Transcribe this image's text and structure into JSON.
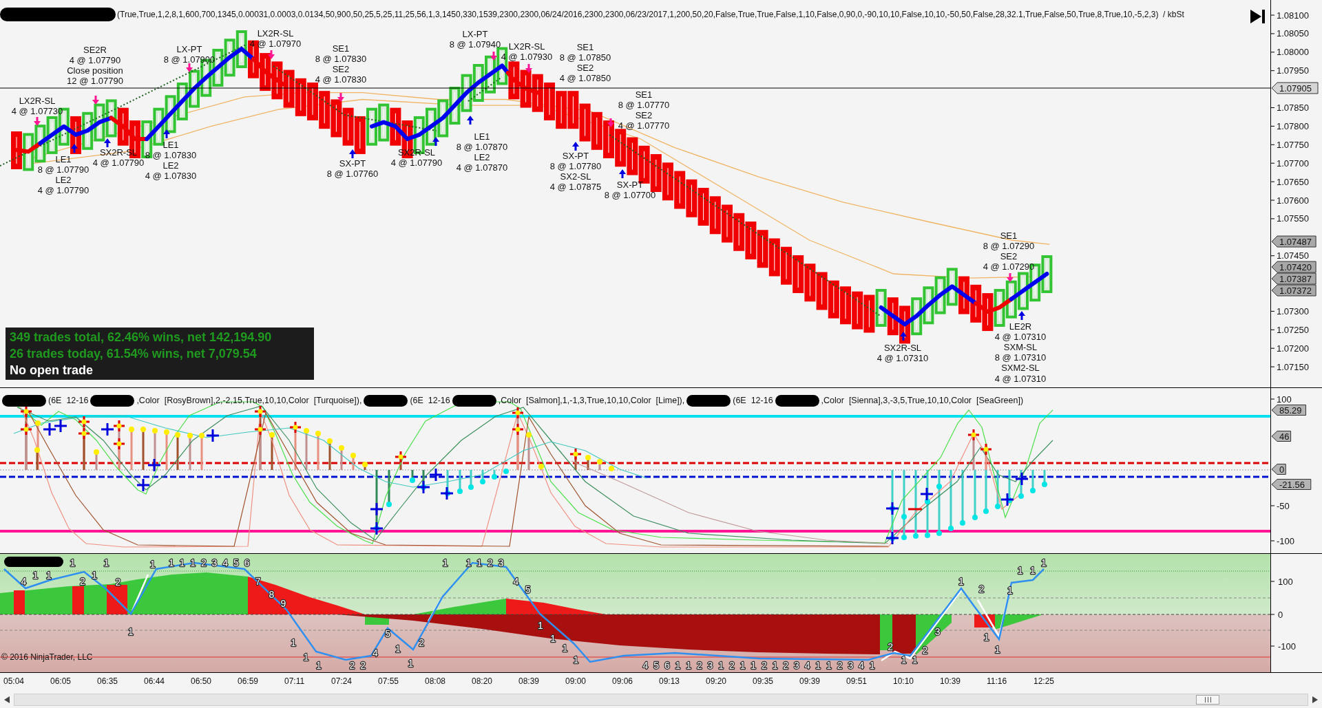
{
  "price_panel": {
    "header": [
      {
        "kind": "redacted"
      },
      {
        "kind": "text",
        "text": "(True,True,1,2,8,1,600,700,1345,0.00031,0.0003,0.0134,50,900,50,25,5,25,11,25,56,1,3,1450,330,1539,2300,2300,06/24/2016,2300,2300,06/23/2017,1,200,50,20,False,True,True,False,1,10,False,0,90,0,-90,10,10,False,10,10,-50,50,False,28,32.1,True,False,50,True,8,True,10,-5,2,3)  / kbSt"
      }
    ],
    "trade_annotations": [
      {
        "lines": [
          "SE2R",
          "4 @ 1.07790",
          "Close position",
          "12 @ 1.07790"
        ]
      },
      {
        "lines": [
          "LX-PT",
          "8 @ 1.07900"
        ]
      },
      {
        "lines": [
          "LX2R-SL",
          "4 @ 1.07970"
        ]
      },
      {
        "lines": [
          "SE1",
          "8 @ 1.07830",
          "SE2",
          "4 @ 1.07830"
        ]
      },
      {
        "lines": [
          "LX-PT",
          "8 @ 1.07940"
        ]
      },
      {
        "lines": [
          "LX2R-SL",
          "4 @ 1.07930"
        ]
      },
      {
        "lines": [
          "SE1",
          "8 @ 1.07850",
          "SE2",
          "4 @ 1.07850"
        ]
      },
      {
        "lines": [
          "LX2R-SL",
          "4 @ 1.07730"
        ]
      },
      {
        "lines": [
          "SE1",
          "8 @ 1.07770",
          "SE2",
          "4 @ 1.07770"
        ]
      },
      {
        "lines": [
          "LE1",
          "8 @ 1.07790",
          "LE2",
          "4 @ 1.07790"
        ]
      },
      {
        "lines": [
          "SX2R-SL",
          "4 @ 1.07790"
        ]
      },
      {
        "lines": [
          "LE1",
          "8 @ 1.07830",
          "LE2",
          "4 @ 1.07830"
        ]
      },
      {
        "lines": [
          "SX-PT",
          "8 @ 1.07760"
        ]
      },
      {
        "lines": [
          "SX2R-SL",
          "4 @ 1.07790"
        ]
      },
      {
        "lines": [
          "LE1",
          "8 @ 1.07870",
          "LE2",
          "4 @ 1.07870"
        ]
      },
      {
        "lines": [
          "SX-PT",
          "8 @ 1.07780",
          "SX2-SL",
          "4 @ 1.07875"
        ]
      },
      {
        "lines": [
          "SX-PT",
          "8 @ 1.07700"
        ]
      },
      {
        "lines": [
          "SE1",
          "8 @ 1.07290",
          "SE2",
          "4 @ 1.07290"
        ]
      },
      {
        "lines": [
          "SX2R-SL",
          "4 @ 1.07310"
        ]
      },
      {
        "lines": [
          "LE2R",
          "4 @ 1.07310",
          "SXM-SL",
          "8 @ 1.07310",
          "SXM2-SL",
          "4 @ 1.07310"
        ]
      }
    ],
    "stats": [
      {
        "text": "349 trades total, 62.46% wins, net 142,194.90",
        "color": "#1f9a1f"
      },
      {
        "text": "26 trades today, 61.54% wins, net 7,079.54",
        "color": "#1f9a1f"
      },
      {
        "text": "No open trade",
        "color": "#ffffff"
      }
    ],
    "axis_labels": [
      "1.08100",
      "1.08050",
      "1.08000",
      "1.07950",
      "1.07850",
      "1.07800",
      "1.07750",
      "1.07700",
      "1.07650",
      "1.07600",
      "1.07550",
      "1.07450",
      "1.07300",
      "1.07250",
      "1.07200",
      "1.07150"
    ],
    "price_tags": [
      {
        "text": "1.07905",
        "kind": "line"
      },
      {
        "text": "1.07487",
        "kind": "plot"
      },
      {
        "text": "1.07420",
        "kind": "plot"
      },
      {
        "text": "1.07387",
        "kind": "plot"
      },
      {
        "text": "1.07372",
        "kind": "plot"
      }
    ]
  },
  "oscillator_panel": {
    "header": [
      {
        "kind": "redacted"
      },
      {
        "kind": "text",
        "text": "(6E  12-16"
      },
      {
        "kind": "redacted"
      },
      {
        "kind": "text",
        "text": ",Color  [RosyBrown],2,-2,15,True,10,10,Color  [Turquoise]),"
      },
      {
        "kind": "redacted"
      },
      {
        "kind": "text",
        "text": "(6E  12-16"
      },
      {
        "kind": "redacted"
      },
      {
        "kind": "text",
        "text": ",Color  [Salmon],1,-1,3,True,10,10,Color  [Lime]),"
      },
      {
        "kind": "redacted"
      },
      {
        "kind": "text",
        "text": "(6E  12-16"
      },
      {
        "kind": "redacted"
      },
      {
        "kind": "text",
        "text": ",Color  [Sienna],3,-3,5,True,10,10,Color  [SeaGreen])"
      }
    ],
    "axis_labels": [
      "100",
      "-50",
      "-100"
    ],
    "value_tags": [
      "85.29",
      "46",
      "0",
      "-21.56"
    ]
  },
  "count_panel": {
    "header": [
      {
        "kind": "redacted"
      }
    ],
    "wave_counts": [
      "4",
      "1",
      "1",
      "1",
      "2",
      "1",
      "1",
      "2",
      "1",
      "1",
      "1 1 1 2 3 4 5 6",
      "7",
      "8",
      "9",
      "1",
      "1",
      "1",
      "2 2",
      "4",
      "5",
      "1",
      "1",
      "2",
      "1",
      "1 1 2 3",
      "4",
      "5",
      "1",
      "1",
      "1",
      "1",
      "4 5 6 1 1 2 3 1 2 1 1 2 1 2 3 4 1 1 2 3 4 1",
      "2",
      "1",
      "1",
      "2",
      "3",
      "1",
      "2",
      "1",
      "1",
      "1",
      "1",
      "1",
      "1"
    ],
    "axis_labels": [
      "100",
      "0",
      "-100"
    ],
    "copyright": "© 2016 NinjaTrader, LLC"
  },
  "time_axis": {
    "labels": [
      "05:04",
      "06:05",
      "06:35",
      "06:44",
      "06:50",
      "06:59",
      "07:11",
      "07:24",
      "07:55",
      "08:08",
      "08:20",
      "08:39",
      "09:00",
      "09:06",
      "09:13",
      "09:20",
      "09:35",
      "09:39",
      "09:51",
      "10:10",
      "10:39",
      "11:16",
      "12:25"
    ]
  }
}
